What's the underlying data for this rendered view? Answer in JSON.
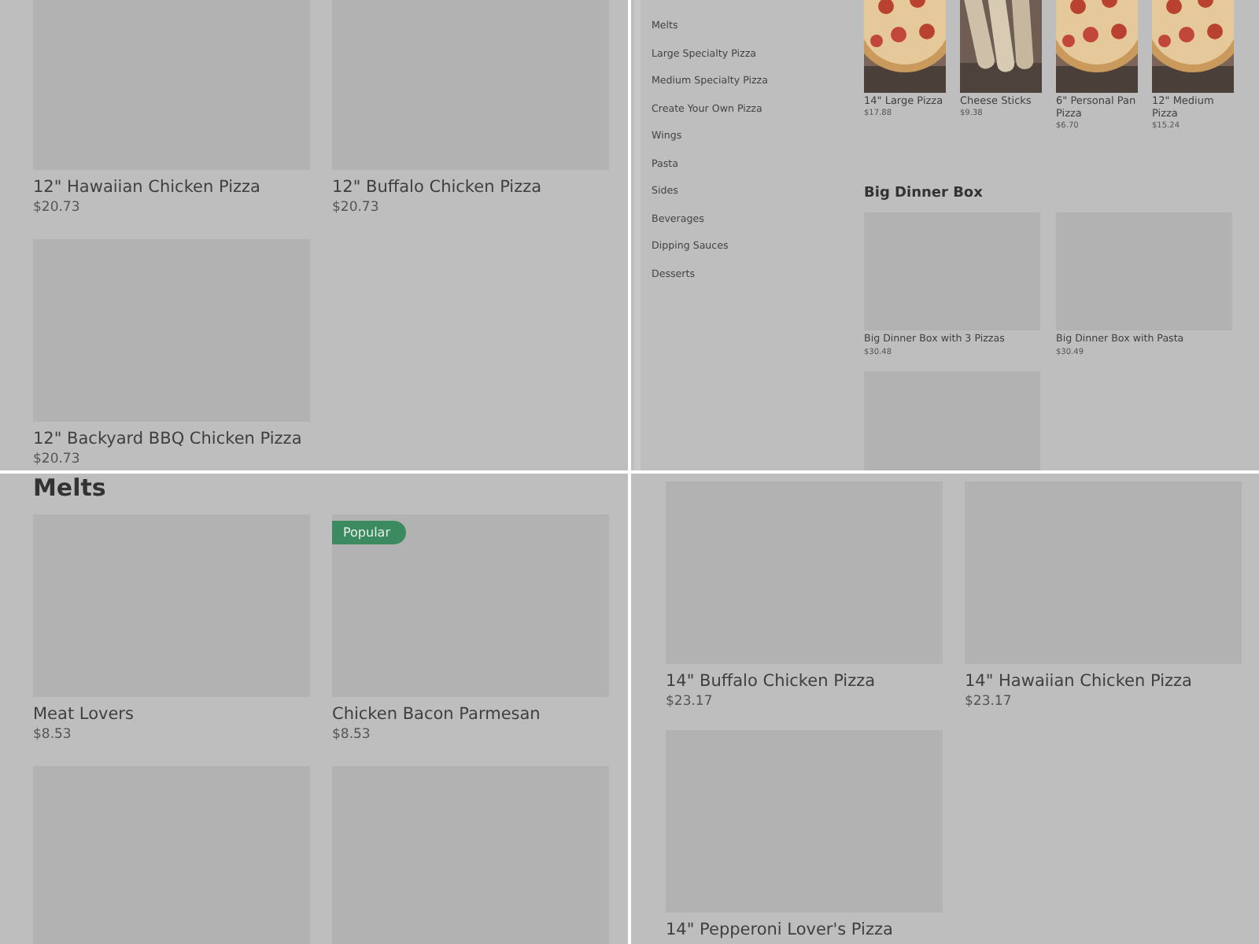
{
  "panels": [
    {
      "kind": "grid",
      "cards": [
        {
          "kind": "placeholder",
          "title": "12\" Hawaiian Chicken Pizza",
          "price": "$20.73"
        },
        {
          "kind": "placeholder",
          "title": "12\" Buffalo Chicken Pizza",
          "price": "$20.73"
        },
        {
          "kind": "placeholder",
          "title": "12\" Backyard BBQ Chicken Pizza",
          "price": "$20.73"
        }
      ]
    },
    {
      "kind": "menu",
      "sidebar": {
        "items": [
          "Melts",
          "Large Specialty Pizza",
          "Medium Specialty Pizza",
          "Create Your Own Pizza",
          "Wings",
          "Pasta",
          "Sides",
          "Beverages",
          "Dipping Sauces",
          "Desserts"
        ]
      },
      "sections": [
        {
          "cards": [
            {
              "title": "14\" Large Pizza",
              "price": "$17.88"
            },
            {
              "title": "Cheese Sticks",
              "price": "$9.38"
            },
            {
              "title": "6\" Personal Pan Pizza",
              "price": "$6.70"
            },
            {
              "title": "12\" Medium Pizza",
              "price": "$15.24"
            }
          ]
        },
        {
          "heading": "Big Dinner Box",
          "cards": [
            {
              "kind": "placeholder",
              "title": "Big Dinner Box with 3 Pizzas",
              "price": "$30.48"
            },
            {
              "kind": "placeholder",
              "title": "Big Dinner Box with Pasta",
              "price": "$30.49"
            },
            {
              "kind": "placeholder"
            }
          ]
        }
      ]
    },
    {
      "kind": "grid",
      "heading": "Melts",
      "cards": [
        {
          "kind": "placeholder",
          "title": "Meat Lovers",
          "price": "$8.53"
        },
        {
          "kind": "placeholder",
          "badge": "Popular",
          "title": "Chicken Bacon Parmesan",
          "price": "$8.53"
        },
        {
          "kind": "placeholder"
        },
        {
          "kind": "placeholder"
        }
      ]
    },
    {
      "kind": "grid",
      "cards": [
        {
          "kind": "placeholder",
          "title": "14\" Buffalo Chicken Pizza",
          "price": "$23.17"
        },
        {
          "kind": "placeholder",
          "title": "14\" Hawaiian Chicken Pizza",
          "price": "$23.17"
        },
        {
          "kind": "placeholder",
          "title": "14\" Pepperoni Lover's Pizza"
        }
      ]
    }
  ]
}
